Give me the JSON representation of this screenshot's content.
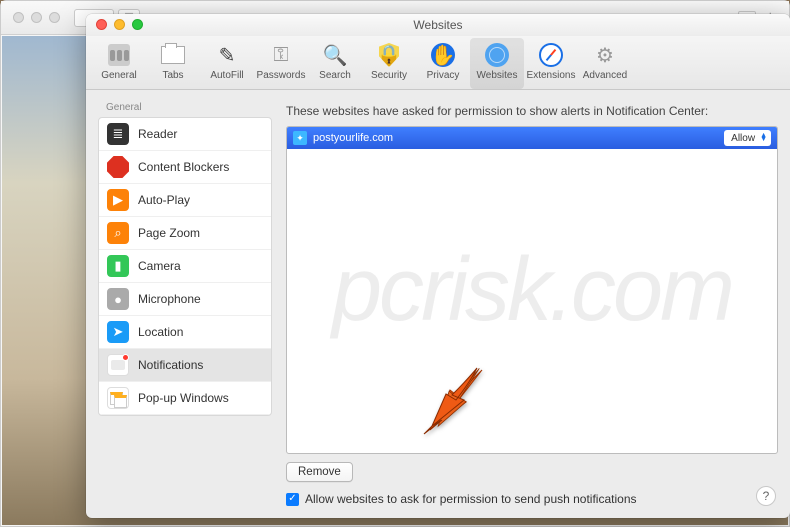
{
  "window": {
    "title": "Websites"
  },
  "toolbar": {
    "items": [
      {
        "label": "General"
      },
      {
        "label": "Tabs"
      },
      {
        "label": "AutoFill"
      },
      {
        "label": "Passwords"
      },
      {
        "label": "Search"
      },
      {
        "label": "Security"
      },
      {
        "label": "Privacy"
      },
      {
        "label": "Websites"
      },
      {
        "label": "Extensions"
      },
      {
        "label": "Advanced"
      }
    ],
    "selected_index": 7
  },
  "sidebar": {
    "header": "General",
    "items": [
      {
        "label": "Reader"
      },
      {
        "label": "Content Blockers"
      },
      {
        "label": "Auto-Play"
      },
      {
        "label": "Page Zoom"
      },
      {
        "label": "Camera"
      },
      {
        "label": "Microphone"
      },
      {
        "label": "Location"
      },
      {
        "label": "Notifications"
      },
      {
        "label": "Pop-up Windows"
      }
    ],
    "selected_index": 7
  },
  "main": {
    "instruction": "These websites have asked for permission to show alerts in Notification Center:",
    "sites": [
      {
        "domain": "postyourlife.com",
        "permission": "Allow"
      }
    ],
    "remove_label": "Remove",
    "checkbox_checked": true,
    "checkbox_label": "Allow websites to ask for permission to send push notifications"
  },
  "help_label": "?",
  "watermark": "pcrisk.com"
}
